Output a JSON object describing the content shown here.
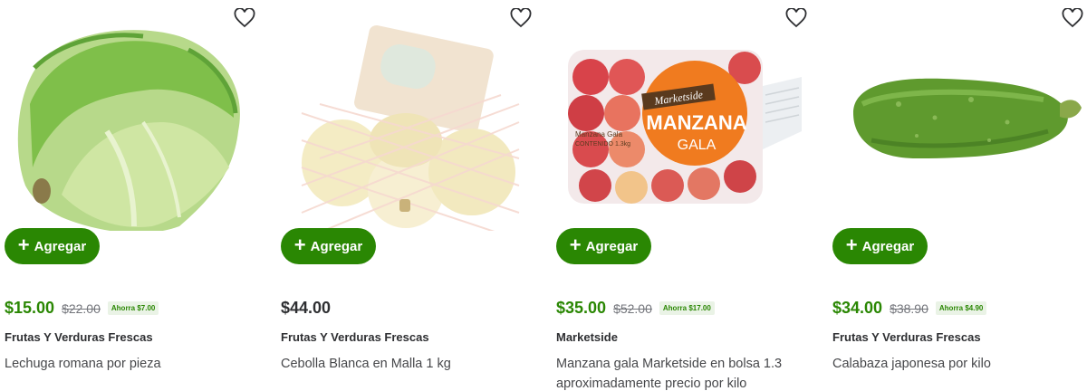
{
  "products": [
    {
      "image": "lettuce",
      "add_label": "Agregar",
      "price": "$15.00",
      "was_price": "$22.00",
      "savings": "Ahorra $7.00",
      "brand": "Frutas Y Verduras Frescas",
      "name": "Lechuga romana por pieza"
    },
    {
      "image": "onion-mesh-bag",
      "add_label": "Agregar",
      "price": "$44.00",
      "was_price": "",
      "savings": "",
      "brand": "Frutas Y Verduras Frescas",
      "name": "Cebolla Blanca en Malla 1 kg"
    },
    {
      "image": "apple-bag",
      "add_label": "Agregar",
      "price": "$35.00",
      "was_price": "$52.00",
      "savings": "Ahorra $17.00",
      "brand": "Marketside",
      "name": "Manzana gala Marketside en bolsa 1.3 aproximadamente precio por kilo",
      "package_text": {
        "brand": "Marketside",
        "line1": "MANZANA",
        "line2": "GALA",
        "small1": "Manzana Gala",
        "small2": "CONTENIDO 1.3kg"
      }
    },
    {
      "image": "zucchini",
      "add_label": "Agregar",
      "price": "$34.00",
      "was_price": "$38.90",
      "savings": "Ahorra $4.90",
      "brand": "Frutas Y Verduras Frescas",
      "name": "Calabaza japonesa por kilo"
    }
  ],
  "colors": {
    "accent": "#2a8703",
    "badge_bg": "#eaf3e6"
  }
}
